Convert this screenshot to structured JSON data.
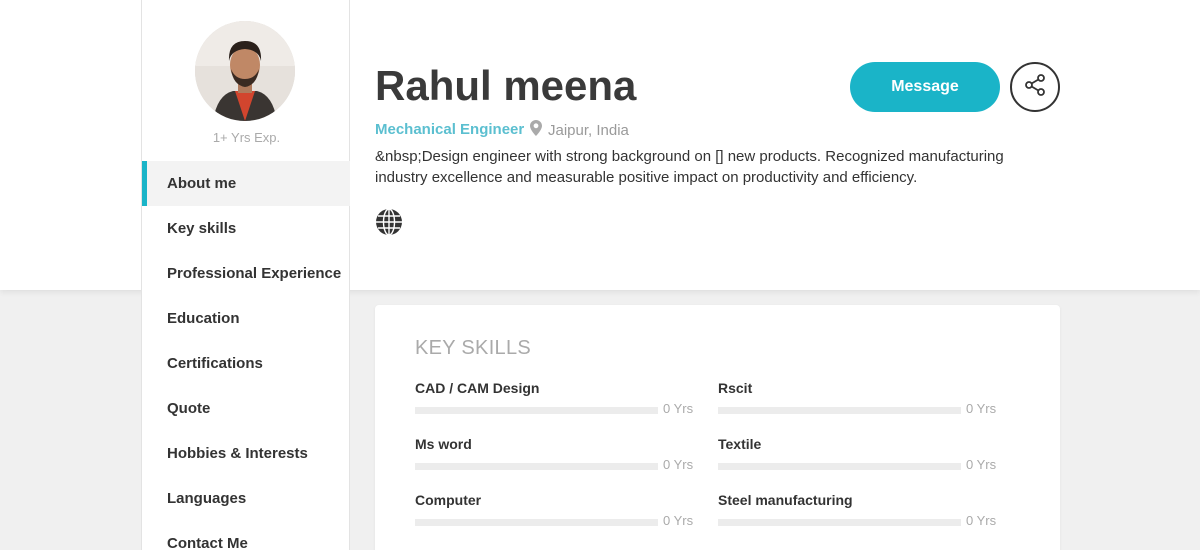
{
  "profile": {
    "experience": "1+ Yrs Exp.",
    "name": "Rahul meena",
    "role": "Mechanical Engineer",
    "location": "Jaipur, India",
    "bio": "&nbsp;Design engineer with strong background on [] new products. Recognized manufacturing industry excellence and measurable positive impact on productivity and efficiency."
  },
  "actions": {
    "message_label": "Message"
  },
  "nav": {
    "items": [
      {
        "label": "About me",
        "active": true
      },
      {
        "label": "Key skills",
        "active": false
      },
      {
        "label": "Professional Experience",
        "active": false
      },
      {
        "label": "Education",
        "active": false
      },
      {
        "label": "Certifications",
        "active": false
      },
      {
        "label": "Quote",
        "active": false
      },
      {
        "label": "Hobbies & Interests",
        "active": false
      },
      {
        "label": "Languages",
        "active": false
      },
      {
        "label": "Contact Me",
        "active": false
      }
    ]
  },
  "skills": {
    "title": "KEY SKILLS",
    "items": [
      {
        "name": "CAD / CAM Design",
        "years": "0 Yrs",
        "level": 0
      },
      {
        "name": "Rscit",
        "years": "0 Yrs",
        "level": 0
      },
      {
        "name": "Ms word",
        "years": "0 Yrs",
        "level": 0
      },
      {
        "name": "Textile",
        "years": "0 Yrs",
        "level": 0
      },
      {
        "name": "Computer",
        "years": "0 Yrs",
        "level": 0
      },
      {
        "name": "Steel manufacturing",
        "years": "0 Yrs",
        "level": 0
      }
    ]
  },
  "icons": {
    "location": "map-pin-icon",
    "website": "globe-icon",
    "share": "share-icon"
  },
  "colors": {
    "accent": "#1ab4c8",
    "role_text": "#5bbfd0"
  }
}
